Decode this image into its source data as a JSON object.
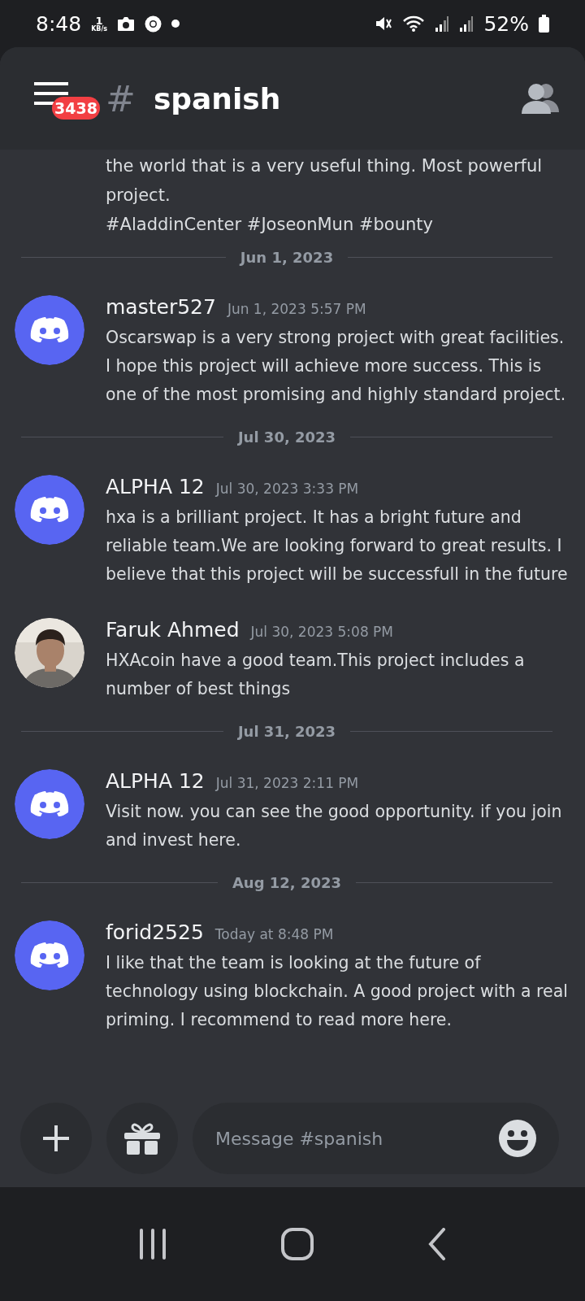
{
  "status_bar": {
    "time": "8:48",
    "net_speed": "1",
    "net_unit": "KB/s",
    "battery": "52%"
  },
  "header": {
    "badge": "3438",
    "hash": "#",
    "channel": "spanish"
  },
  "feed": [
    {
      "kind": "continuation",
      "lines": [
        "the world that is a very useful thing. Most powerful",
        "project.",
        "#AladdinCenter #JoseonMun #bounty"
      ]
    },
    {
      "kind": "divider",
      "label": "Jun 1, 2023"
    },
    {
      "kind": "message",
      "avatar": {
        "kind": "discord"
      },
      "author": "master527",
      "time": "Jun 1, 2023 5:57 PM",
      "text": "Oscarswap is a very strong project with great facilities. I hope this project will achieve more success. This is one of the most promising and highly standard project."
    },
    {
      "kind": "divider",
      "label": "Jul 30, 2023"
    },
    {
      "kind": "message",
      "avatar": {
        "kind": "discord"
      },
      "author": "ALPHA 12",
      "time": "Jul 30, 2023 3:33 PM",
      "text": "hxa is a brilliant project. It has a bright future and reliable team.We are looking forward to great results. I believe that this project will be successfull in the future"
    },
    {
      "kind": "message",
      "author": "Faruk Ahmed",
      "time": "Jul 30, 2023 5:08 PM",
      "text": "HXAcoin have a good team.This project includes a number of best things"
    },
    {
      "kind": "divider",
      "label": "Jul 31, 2023"
    },
    {
      "kind": "message",
      "avatar": {
        "kind": "discord"
      },
      "author": "ALPHA 12",
      "time": "Jul 31, 2023 2:11 PM",
      "text": "Visit now. you can see the good opportunity. if you join and invest here."
    },
    {
      "kind": "divider",
      "label": "Aug 12, 2023"
    },
    {
      "kind": "message",
      "avatar": {
        "kind": "discord"
      },
      "author": "forid2525",
      "time": "Today at 8:48 PM",
      "text": "I like that the team is looking at the future of technology using blockchain. A good project with a real priming. I recommend to read more here."
    }
  ],
  "composer": {
    "placeholder": "Message #spanish"
  }
}
